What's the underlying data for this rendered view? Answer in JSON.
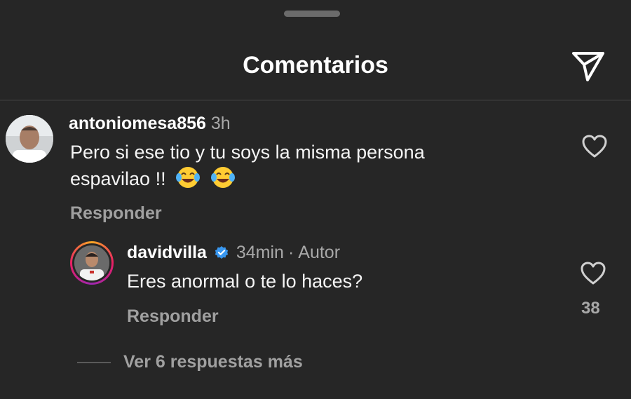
{
  "header": {
    "title": "Comentarios",
    "send_icon": "paper-plane-icon"
  },
  "comment": {
    "username": "antoniomesa856",
    "time": "3h",
    "text_line1": "Pero si ese tio y tu soys la misma persona",
    "text_line2": "espavilao !!",
    "emojis": [
      "tears-of-joy-emoji",
      "tears-of-joy-emoji"
    ],
    "reply_label": "Responder"
  },
  "reply": {
    "username": "davidvilla",
    "verified": true,
    "time": "34min",
    "author_label": "Autor",
    "text": "Eres anormal o te lo haces?",
    "reply_label": "Responder",
    "likes": "38"
  },
  "more_replies": "Ver 6 respuestas más",
  "colors": {
    "background": "#262626",
    "verified_blue": "#3897f0",
    "secondary_text": "#a8a8a8"
  }
}
